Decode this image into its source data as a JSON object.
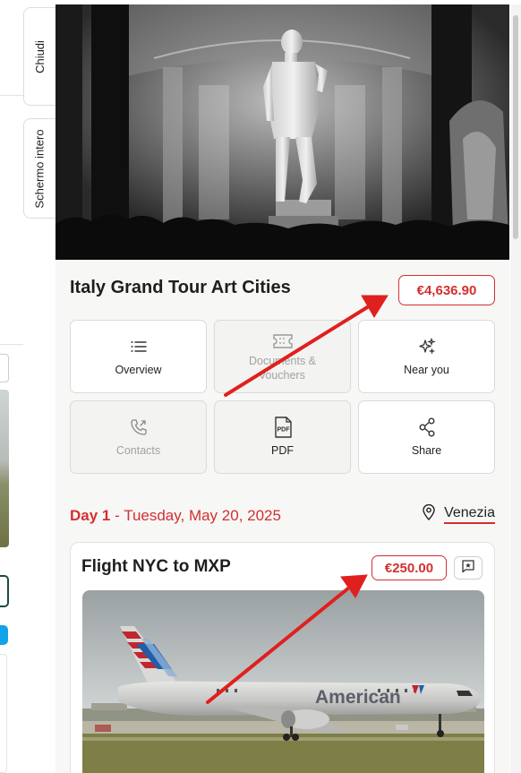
{
  "side_tabs": {
    "close": "Chiudi",
    "fullscreen": "Schermo intero"
  },
  "trip": {
    "title": "Italy Grand Tour Art Cities",
    "price": "€4,636.90"
  },
  "tiles": [
    {
      "label": "Overview",
      "icon": "list-icon"
    },
    {
      "label": "Documents & vouchers",
      "icon": "ticket-icon"
    },
    {
      "label": "Near you",
      "icon": "sparkles-icon"
    },
    {
      "label": "Contacts",
      "icon": "phone-icon"
    },
    {
      "label": "PDF",
      "icon": "pdf-icon"
    },
    {
      "label": "Share",
      "icon": "share-icon"
    }
  ],
  "day": {
    "number": "Day 1",
    "separator": " - ",
    "date": "Tuesday, May 20, 2025",
    "city": "Venezia"
  },
  "flight_card": {
    "title": "Flight NYC to MXP",
    "price": "€250.00",
    "airline_livery": "American"
  },
  "colors": {
    "accent": "#d32f2f",
    "panel_bg": "#f7f7f6",
    "annotation_arrow": "#e0201e"
  }
}
